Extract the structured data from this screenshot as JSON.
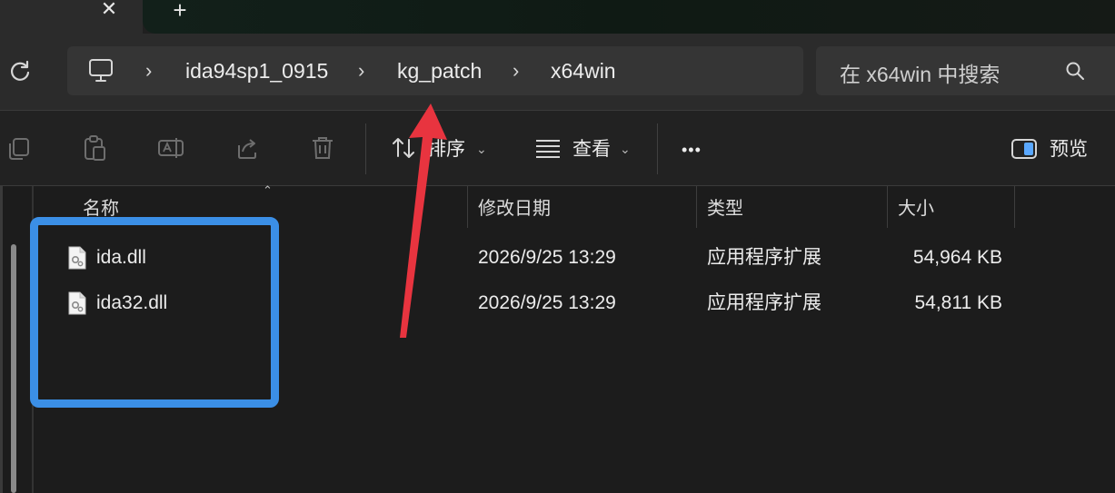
{
  "tabs": {
    "close_glyph": "✕",
    "new_tab_glyph": "+"
  },
  "address": {
    "crumbs": [
      "ida94sp1_0915",
      "kg_patch",
      "x64win"
    ],
    "separator": "›"
  },
  "search": {
    "placeholder": "在 x64win 中搜索"
  },
  "toolbar": {
    "sort_label": "排序",
    "view_label": "查看",
    "more_label": "•••",
    "preview_label": "预览",
    "caret": "⌄"
  },
  "columns": {
    "name": "名称",
    "modified": "修改日期",
    "type": "类型",
    "size": "大小",
    "sort_glyph": "⌃"
  },
  "files": [
    {
      "name": "ida.dll",
      "modified": "2026/9/25 13:29",
      "type": "应用程序扩展",
      "size": "54,964 KB"
    },
    {
      "name": "ida32.dll",
      "modified": "2026/9/25 13:29",
      "type": "应用程序扩展",
      "size": "54,811 KB"
    }
  ],
  "annotations": {
    "highlight_color": "#3b8fe6",
    "arrow_color": "#e8343f"
  },
  "icons": [
    "refresh-icon",
    "computer-icon",
    "search-icon",
    "copy-icon",
    "paste-icon",
    "rename-icon",
    "share-icon",
    "delete-icon",
    "sort-icon",
    "view-icon",
    "preview-pane-icon",
    "dll-file-icon"
  ]
}
